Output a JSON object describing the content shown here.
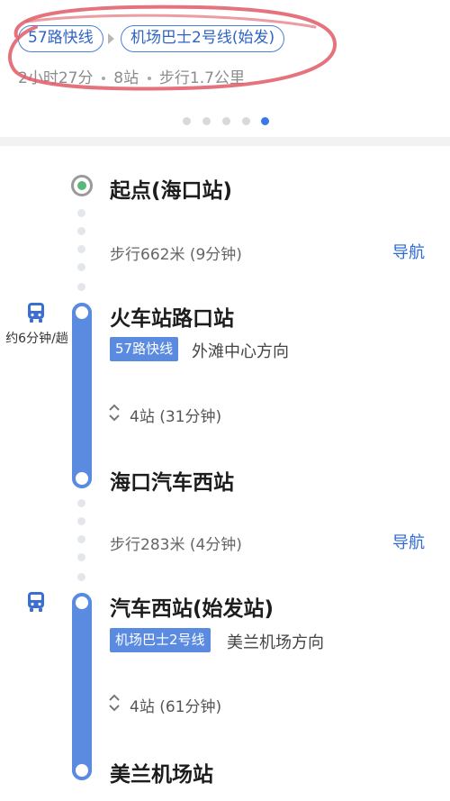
{
  "header": {
    "routes": [
      {
        "label": "57路快线"
      },
      {
        "label": "机场巴士2号线(始发)"
      }
    ],
    "summary": {
      "duration": "2小时27分",
      "stations": "8站",
      "walk": "步行1.7公里"
    },
    "pager": {
      "count": 5,
      "active_index": 4
    }
  },
  "timeline": {
    "start": {
      "name": "起点(海口站)"
    },
    "walk1": {
      "text": "步行662米 (9分钟)",
      "nav": "导航"
    },
    "leg1": {
      "interval": "约6分钟/趟",
      "board_stop": "火车站路口站",
      "line_tag": "57路快线",
      "direction": "外滩中心方向",
      "stops": "4站 (31分钟)",
      "alight_stop": "海口汽车西站"
    },
    "walk2": {
      "text": "步行283米 (4分钟)",
      "nav": "导航"
    },
    "leg2": {
      "board_stop": "汽车西站(始发站)",
      "line_tag": "机场巴士2号线",
      "direction": "美兰机场方向",
      "stops": "4站 (61分钟)",
      "alight_stop": "美兰机场站"
    }
  },
  "colors": {
    "accent": "#3b78e7",
    "line": "#5b8be0",
    "start_dot": "#5cb87a",
    "scribble": "#e05a66"
  },
  "icons": {
    "bus": "bus-icon",
    "updown": "chevron-updown-icon"
  }
}
